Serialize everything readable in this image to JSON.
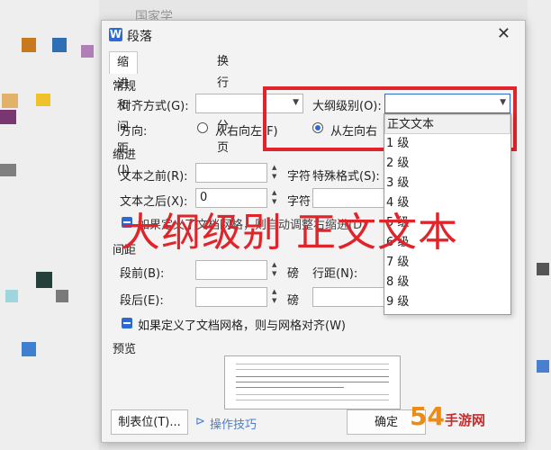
{
  "dialog": {
    "app_icon_letter": "W",
    "title": "段落",
    "close_glyph": "✕"
  },
  "tabs": [
    {
      "label": "缩进和间距(I)",
      "active": true
    },
    {
      "label": "换行和分页(P)",
      "active": false
    }
  ],
  "general": {
    "section_label": "常规",
    "alignment_label": "对齐方式(G):",
    "alignment_value": "",
    "outline_label": "大纲级别(O):",
    "outline_value": "",
    "direction_label": "方向:",
    "rtl_label": "从右向左(F)",
    "ltr_label": "从左向右"
  },
  "indent": {
    "section_label": "缩进",
    "before_label": "文本之前(R):",
    "before_value": "",
    "after_label": "文本之后(X):",
    "after_value": "0",
    "unit": "字符",
    "special_label": "特殊格式(S):",
    "auto_adjust_label": "如果定义了文档网格，则自动调整右缩进(D)"
  },
  "spacing": {
    "section_label": "间距",
    "before_label": "段前(B):",
    "after_label": "段后(E):",
    "unit": "磅",
    "line_label": "行距(N):",
    "grid_align_label": "如果定义了文档网格，则与网格对齐(W)"
  },
  "preview": {
    "section_label": "预览"
  },
  "buttons": {
    "tabs_label": "制表位(T)...",
    "tips_label": "操作技巧",
    "ok_label": "确定"
  },
  "outline_dropdown": {
    "options": [
      "正文文本",
      "1 级",
      "2 级",
      "3 级",
      "4 级",
      "5 级",
      "6 级",
      "7 级",
      "8 级",
      "9 级"
    ],
    "selected_index": 0
  },
  "annotation": {
    "overlay_text": "大纲级别 正文文本",
    "highlight_color": "#e0242a"
  },
  "watermark": {
    "text": "54",
    "site": "手游网"
  },
  "background_text": "国家学"
}
